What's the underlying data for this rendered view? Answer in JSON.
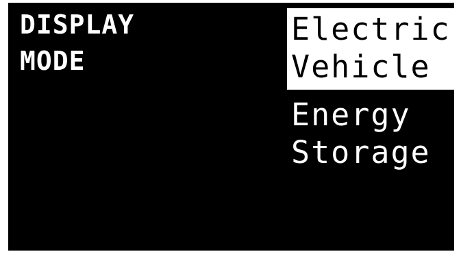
{
  "screen": {
    "title_line_1": "DISPLAY",
    "title_line_2": "MODE"
  },
  "options": [
    {
      "line_1": "Electric",
      "line_2": "Vehicle",
      "selected": true
    },
    {
      "line_1": "Energy",
      "line_2": "Storage",
      "selected": false
    }
  ],
  "colors": {
    "background": "#000000",
    "foreground": "#ffffff",
    "highlight": "#ffffff"
  }
}
